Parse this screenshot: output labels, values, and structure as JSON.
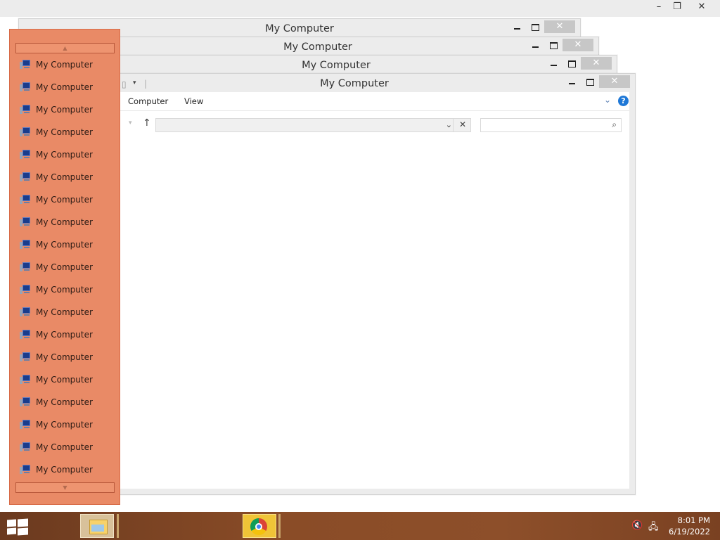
{
  "top_window": {
    "minimize_glyph": "–",
    "restore_glyph": "❐",
    "close_glyph": "✕"
  },
  "windows": [
    {
      "title": "My Computer"
    },
    {
      "title": "My Computer"
    },
    {
      "title": "My Computer"
    },
    {
      "title": "My Computer"
    }
  ],
  "front_window": {
    "title": "My Computer",
    "menu": [
      "Computer",
      "View"
    ],
    "address_value": "",
    "search_placeholder": ""
  },
  "jump_list": {
    "items": [
      "My Computer",
      "My Computer",
      "My Computer",
      "My Computer",
      "My Computer",
      "My Computer",
      "My Computer",
      "My Computer",
      "My Computer",
      "My Computer",
      "My Computer",
      "My Computer",
      "My Computer",
      "My Computer",
      "My Computer",
      "My Computer",
      "My Computer",
      "My Computer",
      "My Computer"
    ],
    "scroll_up_glyph": "▲",
    "scroll_down_glyph": "▼"
  },
  "taskbar": {
    "time": "8:01 PM",
    "date": "6/19/2022",
    "apps": [
      "file-explorer",
      "chrome"
    ]
  },
  "colors": {
    "jump_list_bg": "#e98a66",
    "taskbar": "#8a4c27",
    "help_icon": "#1e78d7"
  }
}
